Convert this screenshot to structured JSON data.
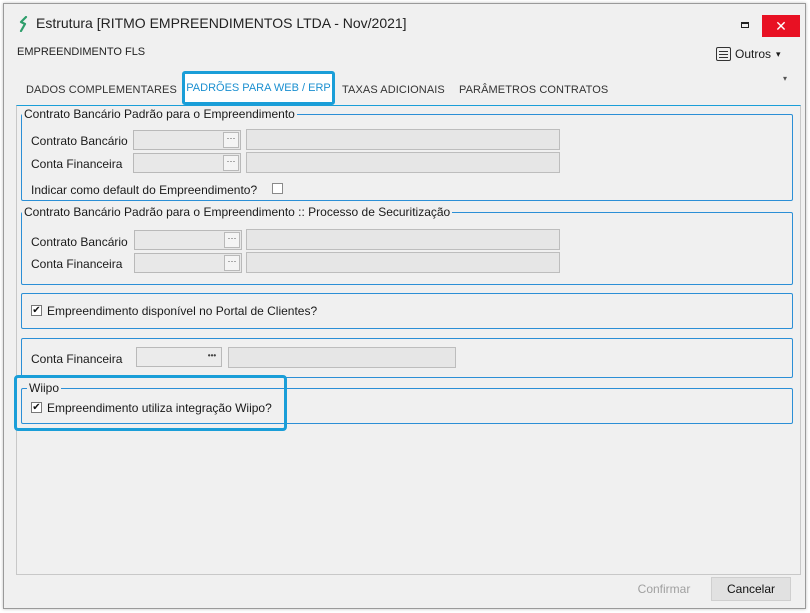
{
  "window": {
    "title": "Estrutura [RITMO EMPREENDIMENTOS LTDA - Nov/2021]",
    "minimize_glyph": "□",
    "close_glyph": "✕"
  },
  "header": {
    "title": "EMPREENDIMENTO FLS",
    "outros_label": "Outros",
    "outros_caret": "▾",
    "scroll_caret": "▾"
  },
  "tabs": [
    {
      "label": "DADOS COMPLEMENTARES",
      "active": false
    },
    {
      "label": "PADRÕES PARA WEB / ERP",
      "active": true
    },
    {
      "label": "TAXAS ADICIONAIS",
      "active": false
    },
    {
      "label": "PARÂMETROS CONTRATOS",
      "active": false
    }
  ],
  "group1": {
    "legend": "Contrato Bancário Padrão para o Empreendimento",
    "contrato_label": "Contrato Bancário",
    "conta_label": "Conta Financeira",
    "contrato_value": "",
    "conta_value": "",
    "default_label": "Indicar como default do Empreendimento?",
    "default_checked": false
  },
  "group2": {
    "legend": "Contrato Bancário Padrão para o Empreendimento  :: Processo de Securitização",
    "contrato_label": "Contrato Bancário",
    "conta_label": "Conta Financeira",
    "contrato_value": "",
    "conta_value": ""
  },
  "portal": {
    "label": "Empreendimento disponível no Portal de Clientes?",
    "checked": true,
    "check_glyph": "✔"
  },
  "conta_financeira": {
    "label": "Conta Financeira",
    "value": "",
    "dots": "•••"
  },
  "wiipo": {
    "legend": "Wiipo",
    "label": "Empreendimento utiliza integração Wiipo?",
    "checked": true,
    "check_glyph": "✔"
  },
  "footer": {
    "confirm_label": "Confirmar",
    "cancel_label": "Cancelar"
  },
  "dots_glyph": "···",
  "colors": {
    "accent": "#1a9ed8",
    "close": "#e81123",
    "group_border": "#2b8fd6"
  }
}
